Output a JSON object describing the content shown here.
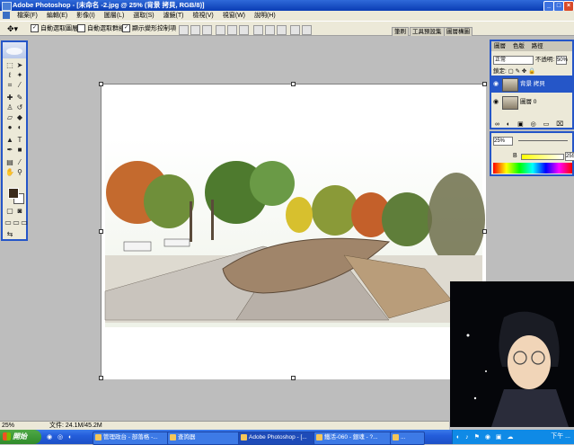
{
  "window": {
    "title": "Adobe Photoshop - [未命名 -2.jpg @ 25% (背景 拷貝, RGB/8)]"
  },
  "menu": {
    "items": [
      "檔案(F)",
      "編輯(E)",
      "影像(I)",
      "圖層(L)",
      "選取(S)",
      "濾鏡(T)",
      "檢視(V)",
      "視窗(W)",
      "說明(H)"
    ]
  },
  "options": {
    "auto_select_layer": "自動選取圖層",
    "auto_select_group": "自動選取群組",
    "show_transform": "顯示變形控制項",
    "palette_tabs": [
      "筆刷",
      "工具預設集",
      "圖層構圖"
    ]
  },
  "layers_panel": {
    "tabs": [
      "圖層",
      "色版",
      "路徑"
    ],
    "blend_mode": "正常",
    "opacity_label": "不透明:",
    "opacity_value": "50%",
    "lock_label": "鎖定:",
    "fill_value": "100%",
    "layers": [
      {
        "name": "背景 拷貝",
        "active": true
      },
      {
        "name": "圖層 0",
        "active": false
      }
    ]
  },
  "color_panel": {
    "zoom": "25%",
    "b_label": "B",
    "b_value": "255"
  },
  "status": {
    "zoom": "25%",
    "doc_size": "文件: 24.1M/45.2M"
  },
  "taskbar": {
    "start": "開始",
    "tasks": [
      "管理政台 - 部落格 -...",
      "查詢器",
      "Adobe Photoshop - [...",
      "鐵活-060 - 銀魂 - ?...",
      "..."
    ],
    "clock": "下午 ..."
  },
  "colors": {
    "title_blue": "#0a3cb4",
    "panel_border": "#2556c8",
    "taskbar_blue": "#245edb"
  }
}
